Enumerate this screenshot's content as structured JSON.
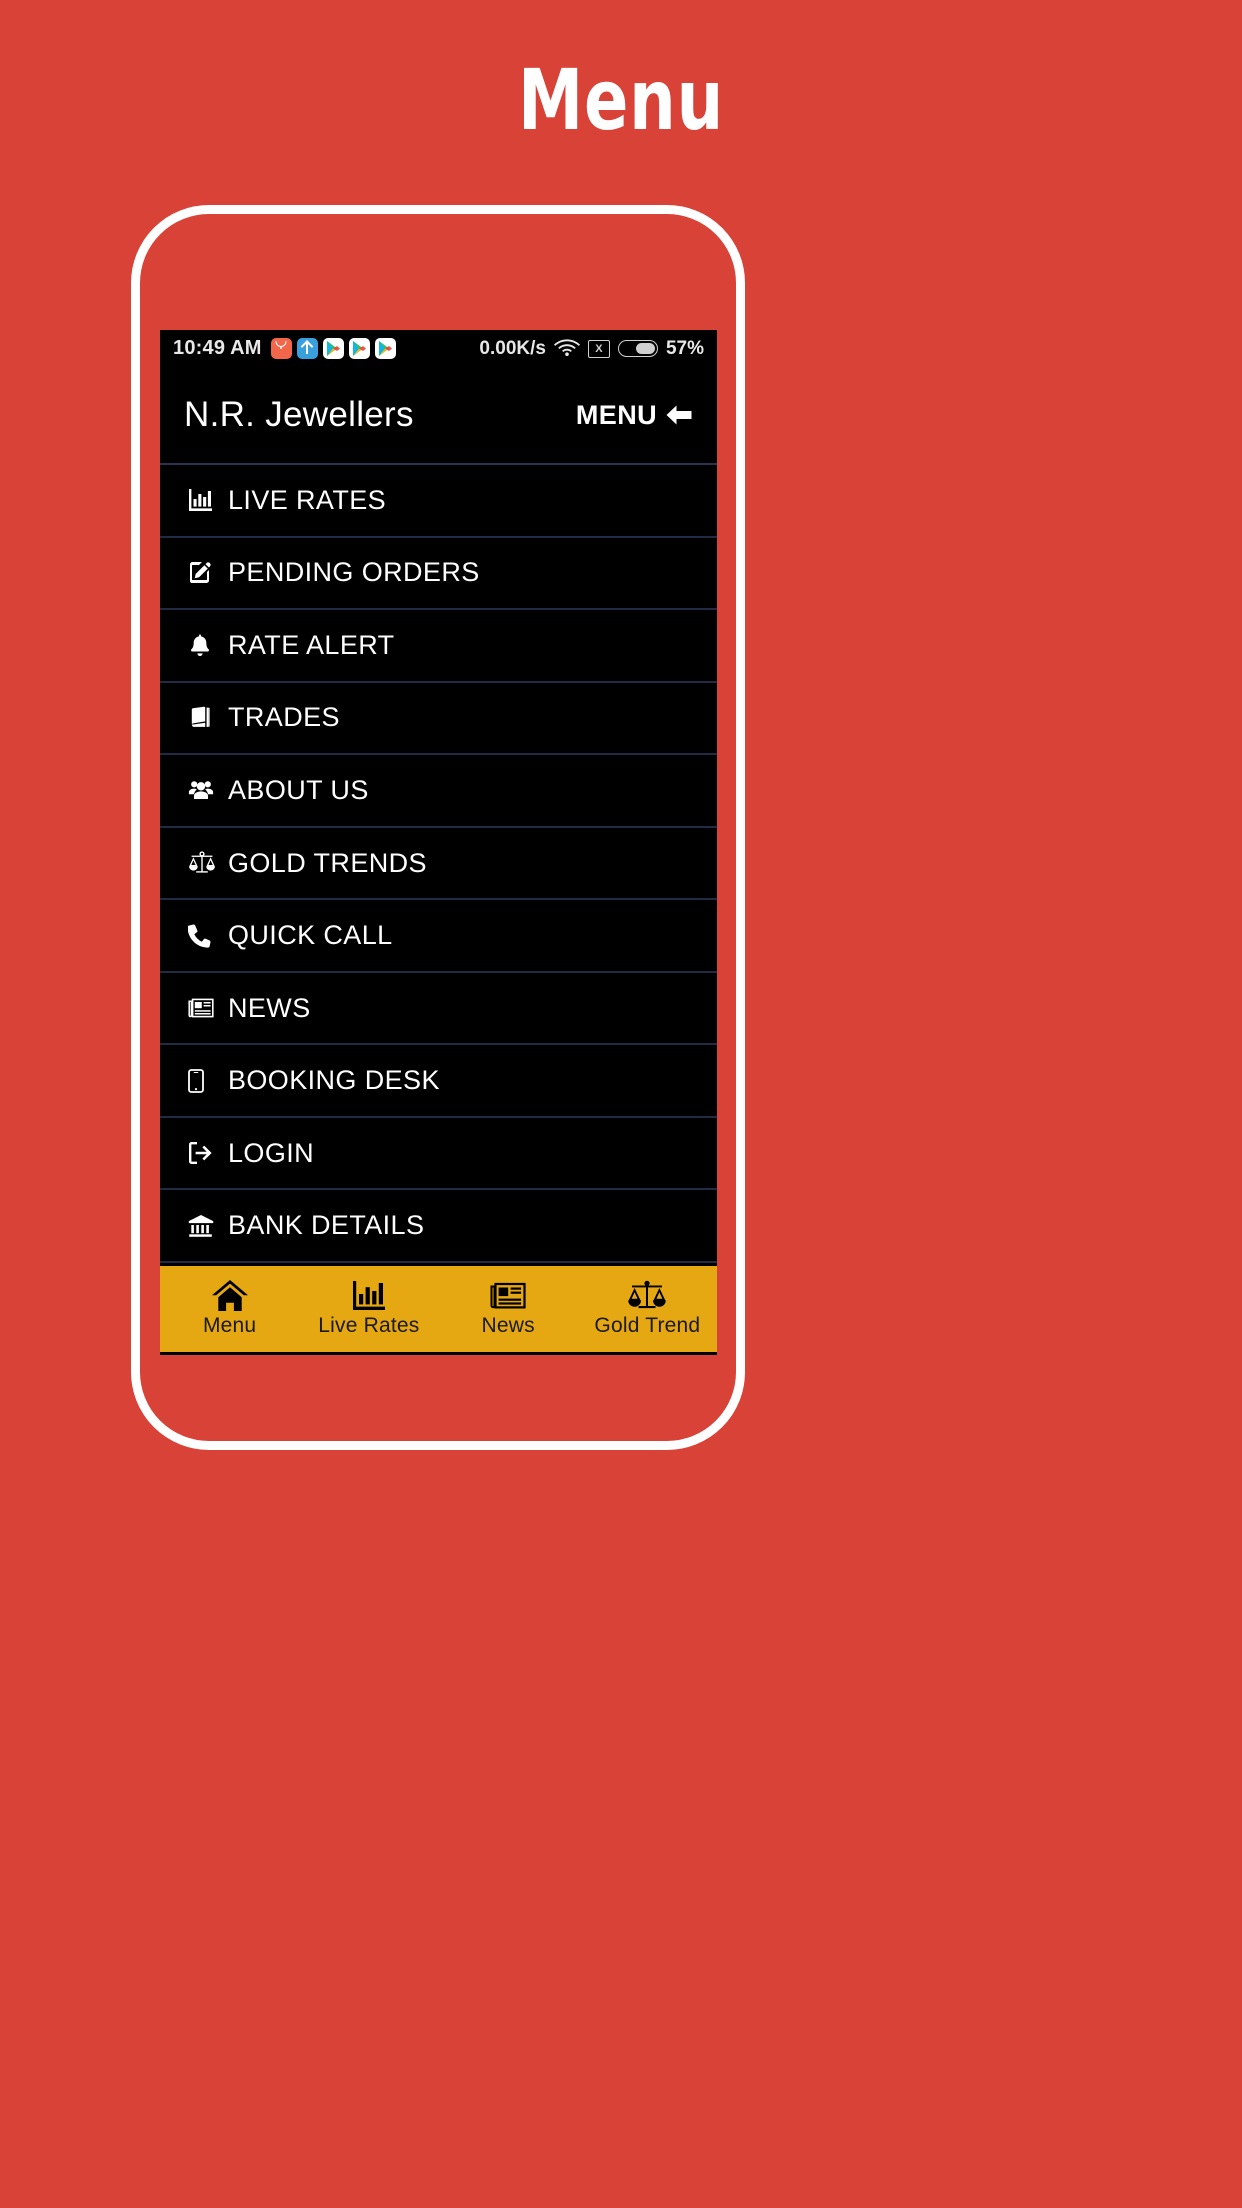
{
  "page": {
    "title": "Menu",
    "background_color": "#d94236"
  },
  "phone": {
    "frame_color": "#ffffff",
    "screen_background": "#000000"
  },
  "statusbar": {
    "time": "10:49 AM",
    "app_icons": [
      "jewellery-shop-icon",
      "upload-arrow-icon",
      "play-store-icon",
      "play-store-icon",
      "play-store-icon"
    ],
    "network_speed": "0.00K/s",
    "wifi_icon": "wifi-icon",
    "sim_icon": "sim-x-icon",
    "sim_label": "X",
    "battery_icon": "battery-icon",
    "battery_percent": "57%"
  },
  "header": {
    "app_name": "N.R. Jewellers",
    "menu_label": "MENU",
    "menu_icon": "arrow-left-icon"
  },
  "menu": {
    "items": [
      {
        "label": "LIVE RATES",
        "icon": "bar-chart-icon"
      },
      {
        "label": "PENDING ORDERS",
        "icon": "edit-square-icon"
      },
      {
        "label": "RATE ALERT",
        "icon": "bell-icon"
      },
      {
        "label": "TRADES",
        "icon": "book-icon"
      },
      {
        "label": "ABOUT US",
        "icon": "users-icon"
      },
      {
        "label": "GOLD TRENDS",
        "icon": "balance-scale-icon"
      },
      {
        "label": "QUICK CALL",
        "icon": "phone-icon"
      },
      {
        "label": "NEWS",
        "icon": "newspaper-icon"
      },
      {
        "label": "BOOKING DESK",
        "icon": "mobile-icon"
      },
      {
        "label": "LOGIN",
        "icon": "sign-out-icon"
      },
      {
        "label": "BANK DETAILS",
        "icon": "bank-icon"
      }
    ]
  },
  "bottom_nav": {
    "background_color": "#e5a812",
    "items": [
      {
        "label": "Menu",
        "icon": "home-icon"
      },
      {
        "label": "Live Rates",
        "icon": "bar-chart-icon"
      },
      {
        "label": "News",
        "icon": "newspaper-icon"
      },
      {
        "label": "Gold Trend",
        "icon": "balance-scale-icon"
      }
    ]
  }
}
